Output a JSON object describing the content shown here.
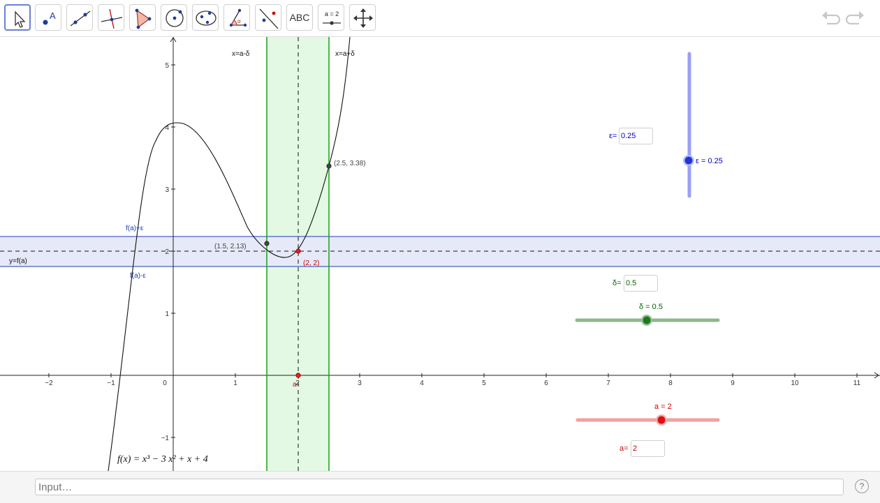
{
  "toolbar": {
    "tools": [
      {
        "name": "move-tool-icon"
      },
      {
        "name": "point-tool-icon"
      },
      {
        "name": "line-tool-icon"
      },
      {
        "name": "perpendicular-line-tool-icon"
      },
      {
        "name": "polygon-tool-icon"
      },
      {
        "name": "circle-tool-icon"
      },
      {
        "name": "ellipse-tool-icon"
      },
      {
        "name": "angle-tool-icon"
      },
      {
        "name": "reflect-tool-icon"
      },
      {
        "name": "text-tool-icon",
        "label": "ABC"
      },
      {
        "name": "slider-tool-icon",
        "label": "a = 2"
      },
      {
        "name": "move-graphics-view-icon"
      }
    ]
  },
  "graph": {
    "function_label": "f(x)  =  x³ − 3 x² + x + 4",
    "x_ticks": [
      "−2",
      "−1",
      "0",
      "1",
      "2",
      "3",
      "4",
      "5",
      "6",
      "7",
      "8",
      "9",
      "10",
      "11"
    ],
    "y_ticks": [
      "−1",
      "1",
      "2",
      "3",
      "4",
      "5"
    ],
    "labels": {
      "x_minus": "x=a-δ",
      "x_plus": "x=a+δ",
      "f_plus": "f(a)+ε",
      "f_minus": "f(a)-ε",
      "y_fa": "y=f(a)",
      "pt_left": "(1.5, 2.13)",
      "pt_right": "(2.5, 3.38)",
      "pt_a": "(2, 2)",
      "a_axis": "a"
    }
  },
  "sliders": {
    "epsilon": {
      "value_label": "ε = 0.25",
      "field_label": "ε=",
      "field_value": "0.25",
      "color": "#0000cc"
    },
    "delta": {
      "value_label": "δ = 0.5",
      "field_label": "δ=",
      "field_value": "0.5",
      "color": "#006400"
    },
    "a": {
      "value_label": "a = 2",
      "field_label": "a=",
      "field_value": "2",
      "color": "#cc0000"
    }
  },
  "input_bar": {
    "placeholder": "Input…",
    "help": "?"
  }
}
